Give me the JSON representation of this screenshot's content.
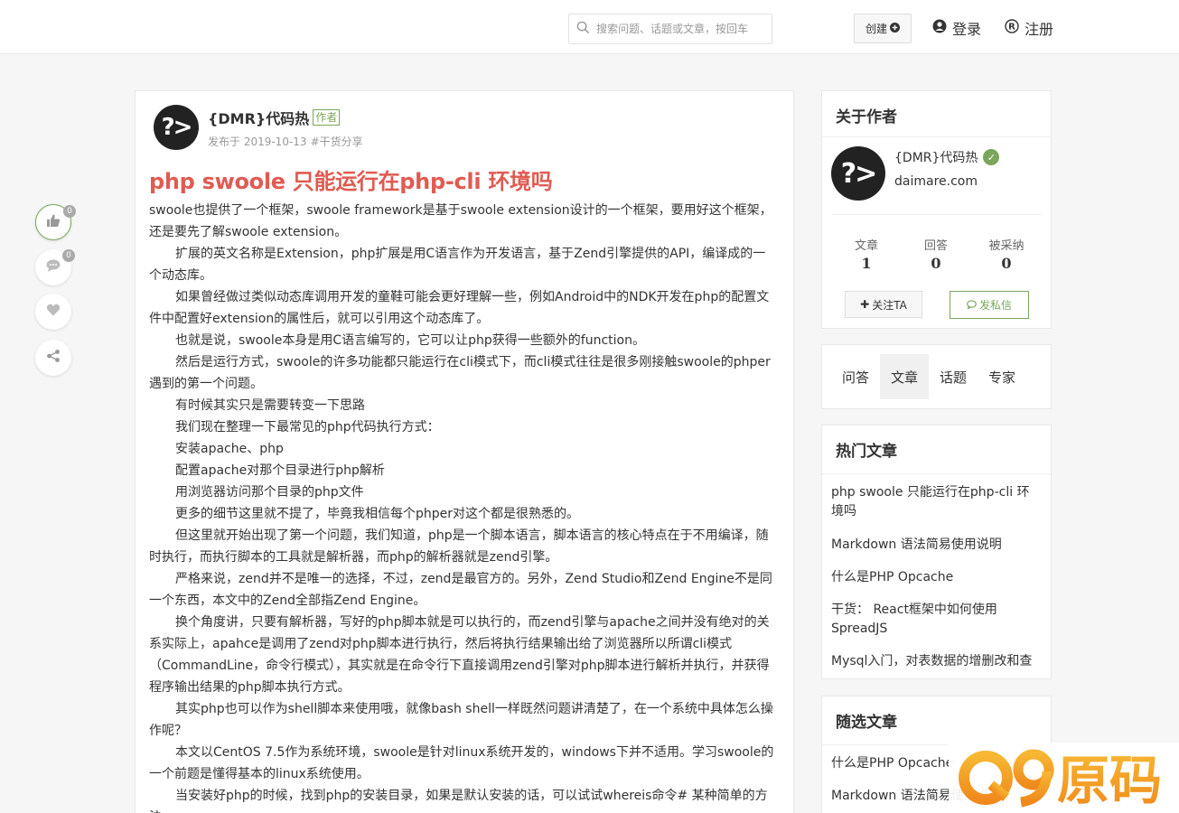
{
  "header": {
    "search_placeholder": "搜索问题、话题或文章，按回车",
    "create_label": "创建",
    "login_label": "登录",
    "register_label": "注册"
  },
  "float_bar": {
    "like_count": "0",
    "comment_count": "0"
  },
  "article": {
    "author_name": "{DMR}代码热",
    "author_tag": "作者",
    "published": "发布于 2019-10-13",
    "category": "#干货分享",
    "title": "php swoole 只能运行在php-cli 环境吗",
    "paragraphs": [
      {
        "indent": false,
        "text": "swoole也提供了一个框架，swoole framework是基于swoole extension设计的一个框架，要用好这个框架，还是要先了解swoole extension。"
      },
      {
        "indent": true,
        "text": "扩展的英文名称是Extension，php扩展是用C语言作为开发语言，基于Zend引擎提供的API，编译成的一个动态库。"
      },
      {
        "indent": true,
        "text": "如果曾经做过类似动态库调用开发的童鞋可能会更好理解一些，例如Android中的NDK开发在php的配置文件中配置好extension的属性后，就可以引用这个动态库了。"
      },
      {
        "indent": true,
        "text": "也就是说，swoole本身是用C语言编写的，它可以让php获得一些额外的function。"
      },
      {
        "indent": true,
        "text": "然后是运行方式，swoole的许多功能都只能运行在cli模式下，而cli模式往往是很多刚接触swoole的phper遇到的第一个问题。"
      },
      {
        "indent": true,
        "text": "有时候其实只是需要转变一下思路"
      },
      {
        "indent": true,
        "text": "我们现在整理一下最常见的php代码执行方式："
      },
      {
        "indent": true,
        "text": "安装apache、php"
      },
      {
        "indent": true,
        "text": "配置apache对那个目录进行php解析"
      },
      {
        "indent": true,
        "text": "用浏览器访问那个目录的php文件"
      },
      {
        "indent": true,
        "text": "更多的细节这里就不提了，毕竟我相信每个phper对这个都是很熟悉的。"
      },
      {
        "indent": true,
        "text": "但这里就开始出现了第一个问题，我们知道，php是一个脚本语言，脚本语言的核心特点在于不用编译，随时执行，而执行脚本的工具就是解析器，而php的解析器就是zend引擎。"
      },
      {
        "indent": true,
        "text": "严格来说，zend并不是唯一的选择，不过，zend是最官方的。另外，Zend Studio和Zend Engine不是同一个东西，本文中的Zend全部指Zend Engine。"
      },
      {
        "indent": true,
        "text": "换个角度讲，只要有解析器，写好的php脚本就是可以执行的，而zend引擎与apache之间并没有绝对的关系实际上，apahce是调用了zend对php脚本进行执行，然后将执行结果输出给了浏览器所以所谓cli模式（CommandLine，命令行模式），其实就是在命令行下直接调用zend引擎对php脚本进行解析并执行，并获得程序输出结果的php脚本执行方式。"
      },
      {
        "indent": true,
        "text": "其实php也可以作为shell脚本来使用哦，就像bash shell一样既然问题讲清楚了，在一个系统中具体怎么操作呢？"
      },
      {
        "indent": true,
        "text": "本文以CentOS 7.5作为系统环境，swoole是针对linux系统开发的，windows下并不适用。学习swoole的一个前题是懂得基本的linux系统使用。"
      },
      {
        "indent": true,
        "text": "当安装好php的时候，找到php的安装目录，如果是默认安装的话，可以试试whereis命令# 某种简单的方法"
      }
    ]
  },
  "sidebar": {
    "about": {
      "title": "关于作者",
      "name": "{DMR}代码热",
      "site": "daimare.com",
      "stats": [
        {
          "label": "文章",
          "value": "1"
        },
        {
          "label": "回答",
          "value": "0"
        },
        {
          "label": "被采纳",
          "value": "0"
        }
      ],
      "follow_label": "关注TA",
      "message_label": "发私信"
    },
    "tabs": [
      "问答",
      "文章",
      "话题",
      "专家"
    ],
    "hot": {
      "title": "热门文章",
      "items": [
        "php swoole 只能运行在php-cli 环境吗",
        "Markdown 语法简易使用说明",
        "什么是PHP Opcache",
        "干货： React框架中如何使用SpreadJS",
        "Mysql入门，对表数据的增删改和查"
      ]
    },
    "random": {
      "title": "随选文章",
      "items": [
        "什么是PHP Opcache",
        "Markdown 语法简易使用说明"
      ]
    }
  },
  "watermark": "Q9源码"
}
